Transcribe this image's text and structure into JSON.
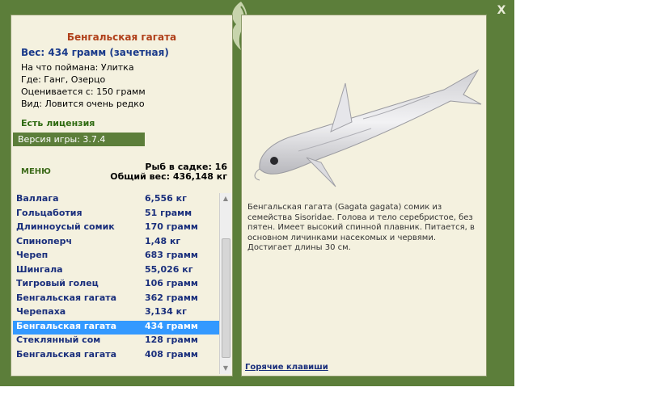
{
  "window": {
    "close_label": "X"
  },
  "fish": {
    "name": "Бенгальская гагата",
    "weight": "Вес: 434 грамм (зачетная)",
    "caught_on": "На что поймана: Улитка",
    "location": "Где: Ганг, Озерцо",
    "valued_from": "Оценивается с: 150 грамм",
    "kind": "Вид: Ловится очень редко",
    "description": "Бенгальская гагата (Gagata gagata) сомик из семейства Sisoridae. Голова и тело серебристое, без пятен. Имеет высокий спинной плавник. Питается, в основном личинками насекомых и червями. Достигает длины 30 см."
  },
  "license_status": "Есть лицензия",
  "version": "Версия игры: 3.7.4",
  "menu_label": "МЕНЮ",
  "keepnet": {
    "count": "Рыб в садке: 16",
    "total": "Общий вес: 436,148 кг"
  },
  "catch_list": [
    {
      "name": "Валлага",
      "weight": "6,556 кг"
    },
    {
      "name": "Гольцаботия",
      "weight": "51 грамм"
    },
    {
      "name": "Длинноусый сомик",
      "weight": "170 грамм"
    },
    {
      "name": "Спиноперч",
      "weight": "1,48 кг"
    },
    {
      "name": "Череп",
      "weight": "683 грамм"
    },
    {
      "name": "Шингала",
      "weight": "55,026 кг"
    },
    {
      "name": "Тигровый голец",
      "weight": "106 грамм"
    },
    {
      "name": "Бенгальская гагата",
      "weight": "362 грамм"
    },
    {
      "name": "Черепаха",
      "weight": "3,134 кг"
    },
    {
      "name": "Бенгальская гагата",
      "weight": "434 грамм",
      "selected": true
    },
    {
      "name": "Стеклянный сом",
      "weight": "128 грамм"
    },
    {
      "name": "Бенгальская гагата",
      "weight": "408 грамм"
    }
  ],
  "hotkeys_label": "Горячие клавиши",
  "colors": {
    "frame": "#5c7e3a",
    "panel": "#f4f1df",
    "selection": "#3399ff",
    "title": "#b0401a",
    "list_text": "#1a2f7c"
  }
}
